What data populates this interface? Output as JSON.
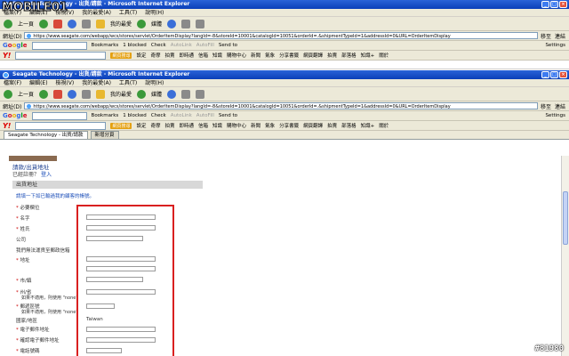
{
  "brand_overlay": {
    "text": "MOBILE01"
  },
  "watermark": "#81980",
  "window1": {
    "title": "Seagate Technology - 出貨/請款 - Microsoft Internet Explorer",
    "menu": [
      "檔案(F)",
      "編輯(E)",
      "檢視(V)",
      "我的最愛(A)",
      "工具(T)",
      "說明(H)"
    ],
    "toolbar": {
      "back": "上一頁",
      "favorites": "我的最愛",
      "media": "媒體"
    },
    "address_label": "網址(D)",
    "address": "https://www.seagate.com/webapp/wcs/stores/servlet/OrderItemDisplay?langId=-8&storeId=10001&catalogId=10051&orderId=.&shipmentTypeId=1&addressId=0&URL=OrderItemDisplay",
    "go": "移至",
    "links": "連結",
    "google": {
      "bookmarks": "Bookmarks",
      "blocked": "1 blocked",
      "check": "Check",
      "autolink": "AutoLink",
      "autofill": "AutoFill",
      "send": "Send to",
      "settings": "Settings"
    },
    "yahoo": {
      "search_btn": "網頁搜尋",
      "items": [
        "設定",
        "奇摩",
        "拍賣",
        "即時通",
        "信箱",
        "知識",
        "購物中心",
        "新聞",
        "氣象",
        "分享書籤",
        "網頁翻譯",
        "拍賣",
        "部落格",
        "知識+",
        "關於"
      ]
    }
  },
  "window2": {
    "title": "Seagate Technology - 出貨/請款 - Microsoft Internet Explorer",
    "menu": [
      "檔案(F)",
      "編輯(E)",
      "檢視(V)",
      "我的最愛(A)",
      "工具(T)",
      "說明(H)"
    ],
    "toolbar": {
      "back": "上一頁",
      "favorites": "我的最愛",
      "media": "媒體"
    },
    "address_label": "網址(D)",
    "address": "https://www.seagate.com/webapp/wcs/stores/servlet/OrderItemDisplay?langId=-8&storeId=10001&catalogId=10051&orderId=.&shipmentTypeId=1&addressId=0&URL=OrderItemDisplay",
    "go": "移至",
    "links": "連結",
    "google": {
      "bookmarks": "Bookmarks",
      "blocked": "1 blocked",
      "check": "Check",
      "autolink": "AutoLink",
      "autofill": "AutoFill",
      "send": "Send to",
      "settings": "Settings"
    },
    "yahoo": {
      "search_btn": "網頁搜尋",
      "items": [
        "設定",
        "奇摩",
        "拍賣",
        "即時通",
        "信箱",
        "知識",
        "購物中心",
        "新聞",
        "氣象",
        "分享書籤",
        "網頁翻譯",
        "拍賣",
        "部落格",
        "知識+",
        "關於"
      ]
    }
  },
  "tabs": [
    "Seagate Technology - 出貨/請款",
    "新增分頁"
  ],
  "form": {
    "page_title": "請款/出貨地址",
    "login_prompt": "已經註冊？",
    "login_link": "登入",
    "section": "出貨地址",
    "hint": "請填一下如已輸過我的顧客的帳號。",
    "required_note": "必要欄位",
    "fields": {
      "first_name": "名字",
      "last_name": "姓氏",
      "company": "公司",
      "po_box_note": "我們無法運貨至郵政信箱",
      "address": "地址",
      "city": "市/鎮",
      "state": "州/省",
      "state_note": "如果不適用，則使用 \"none\"",
      "zip": "郵遞區號",
      "zip_note": "如果不適用，則使用 \"none\"",
      "country": "國家/地區",
      "country_value": "Taiwan",
      "email": "電子郵件地址",
      "email_confirm": "確認電子郵件地址",
      "phone": "電話號碼"
    }
  }
}
